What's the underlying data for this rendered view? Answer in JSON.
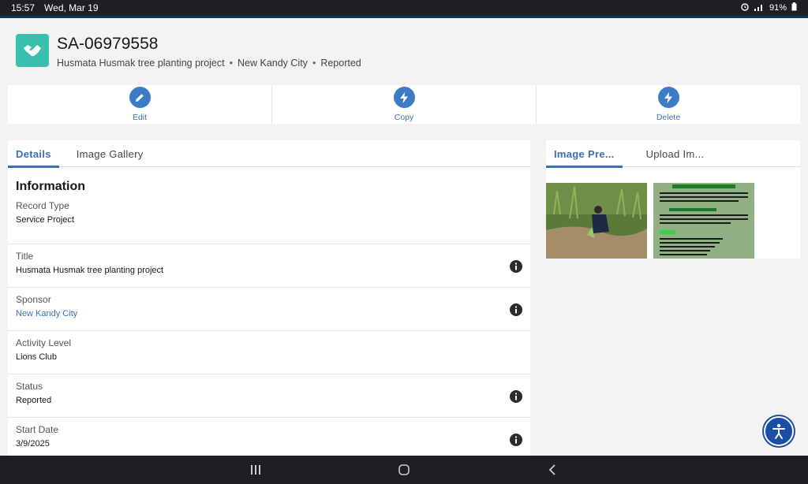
{
  "statusbar": {
    "time": "15:57",
    "date": "Wed, Mar 19",
    "battery": "91%"
  },
  "header": {
    "record_id": "SA-06979558",
    "title": "Husmata Husmak tree planting project",
    "sponsor": "New Kandy City",
    "status": "Reported",
    "icon": "handshake-icon",
    "icon_color": "#3bbfad"
  },
  "actions": [
    {
      "label": "Edit",
      "icon": "pencil-icon"
    },
    {
      "label": "Copy",
      "icon": "lightning-icon"
    },
    {
      "label": "Delete",
      "icon": "lightning-icon"
    }
  ],
  "left_tabs": [
    {
      "label": "Details"
    },
    {
      "label": "Image Gallery"
    }
  ],
  "right_tabs": [
    {
      "label": "Image Pre..."
    },
    {
      "label": "Upload Im..."
    }
  ],
  "details": {
    "section_title": "Information",
    "fields": [
      {
        "label": "Record Type",
        "value": "Service Project"
      },
      {
        "label": "Title",
        "value": "Husmata Husmak tree planting project"
      },
      {
        "label": "Sponsor",
        "value": "New Kandy City"
      },
      {
        "label": "Activity Level",
        "value": "Lions Club"
      },
      {
        "label": "Status",
        "value": "Reported"
      },
      {
        "label": "Start Date",
        "value": "3/9/2025"
      }
    ]
  },
  "colors": {
    "accent": "#3c6fb0",
    "action_icon": "#3c7cc7",
    "fab": "#1a4fa8"
  }
}
